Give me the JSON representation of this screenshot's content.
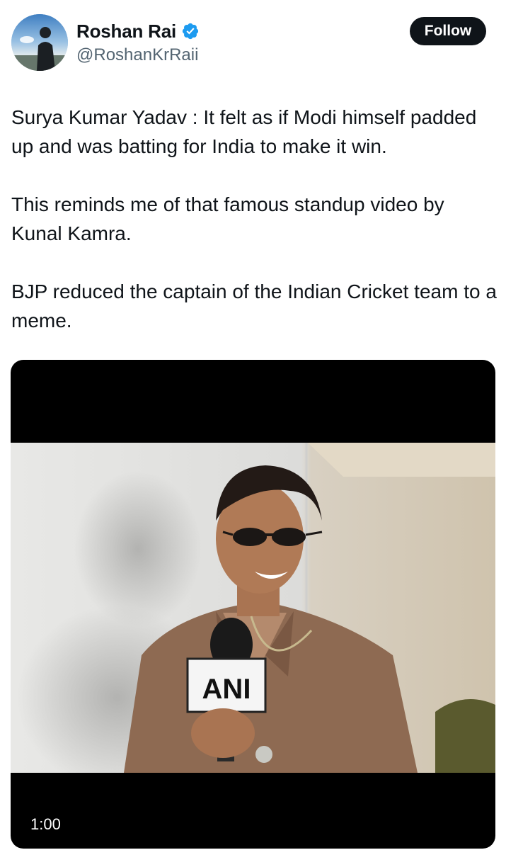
{
  "author": {
    "display_name": "Roshan Rai",
    "handle": "@RoshanKrRaii",
    "verified": true,
    "follow_label": "Follow"
  },
  "tweet": {
    "paragraphs": [
      "Surya Kumar Yadav : It felt as if Modi himself padded up and was batting for India to make it win.",
      "This reminds me of that famous standup video by Kunal Kamra.",
      "BJP reduced the captain of the Indian Cricket team to a meme."
    ]
  },
  "video": {
    "duration": "1:00",
    "mic_logo_text": "ANI"
  },
  "colors": {
    "text_primary": "#0f1419",
    "text_secondary": "#536471",
    "verified_blue": "#1d9bf0",
    "follow_bg": "#0f1419"
  }
}
